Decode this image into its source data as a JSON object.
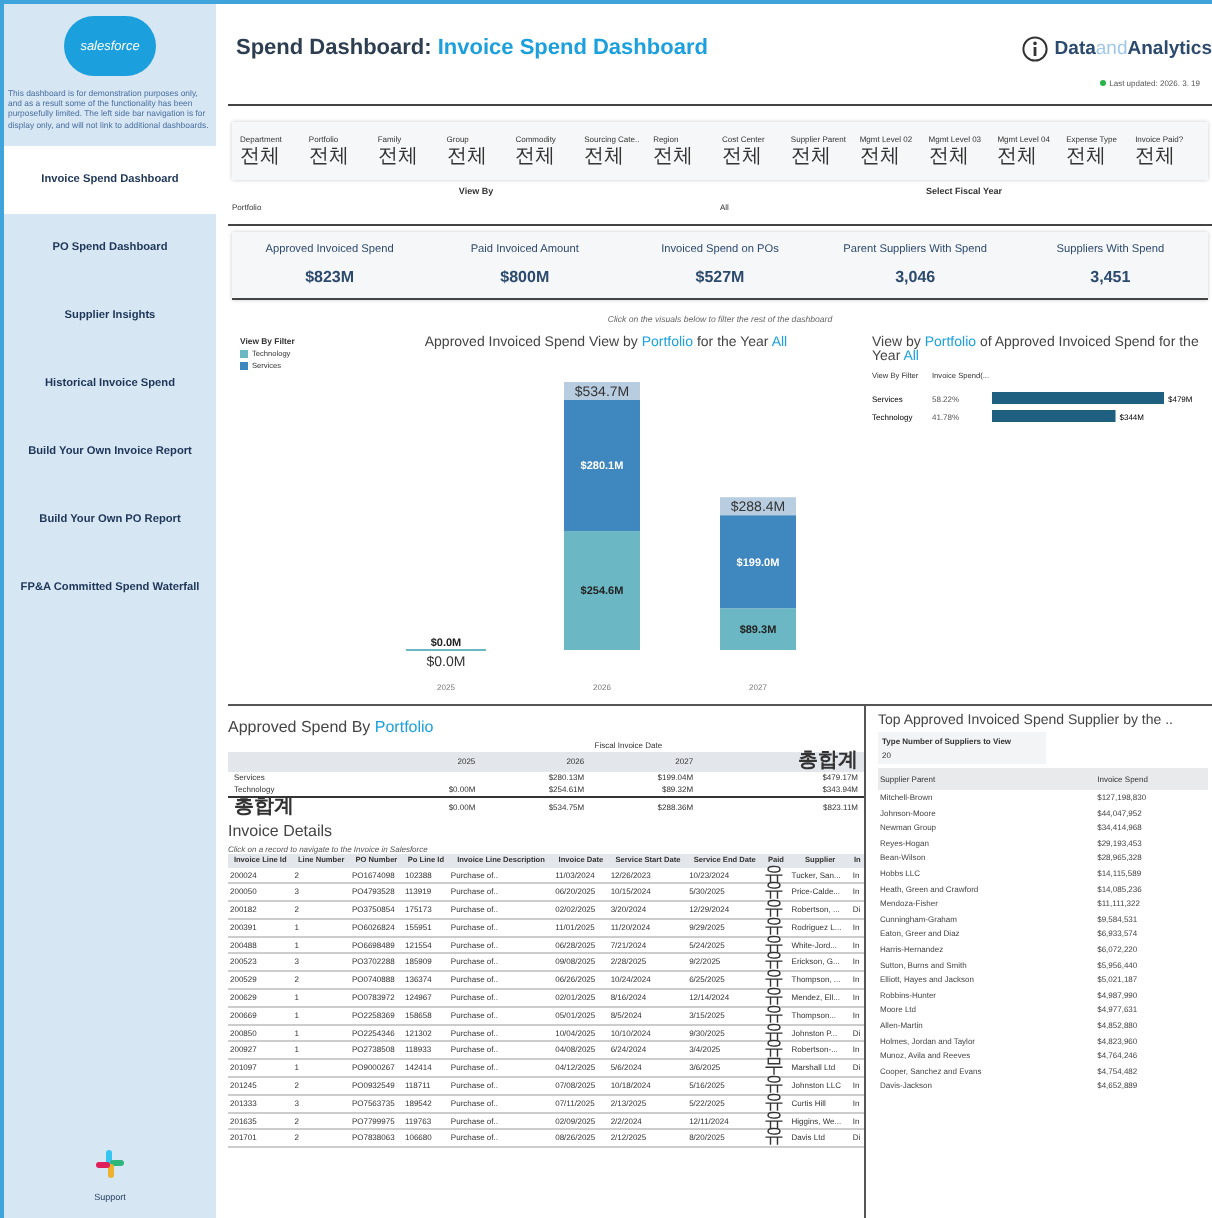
{
  "sidebar": {
    "logo": "salesforce",
    "description": "This dashboard is for demonstration purposes only, and as a result some of the functionality has been purposefully limited. The left side bar navigation is for display only, and will not link to additional dashboards.",
    "items": [
      {
        "label": "Invoice Spend Dashboard",
        "selected": true
      },
      {
        "label": "PO Spend Dashboard",
        "selected": false
      },
      {
        "label": "Supplier Insights",
        "selected": false
      },
      {
        "label": "Historical Invoice Spend",
        "selected": false
      },
      {
        "label": "Build Your Own Invoice Report",
        "selected": false
      },
      {
        "label": "Build Your Own PO Report",
        "selected": false
      },
      {
        "label": "FP&A Committed Spend Waterfall",
        "selected": false
      }
    ],
    "support": "Support"
  },
  "header": {
    "title": "Spend Dashboard:",
    "title_highlight": "Invoice Spend Dashboard",
    "brand": "Data",
    "brand_middle": "and",
    "brand_end": "Analytics",
    "updated": "Last updated: 2026. 3. 19"
  },
  "filters": [
    {
      "label": "Department",
      "value": "전체"
    },
    {
      "label": "Portfolio",
      "value": "전체"
    },
    {
      "label": "Family",
      "value": "전체"
    },
    {
      "label": "Group",
      "value": "전체"
    },
    {
      "label": "Commodity",
      "value": "전체"
    },
    {
      "label": "Sourcing Cate..",
      "value": "전체"
    },
    {
      "label": "Region",
      "value": "전체"
    },
    {
      "label": "Cost Center",
      "value": "전체"
    },
    {
      "label": "Supplier Parent",
      "value": "전체"
    },
    {
      "label": "Mgmt Level 02",
      "value": "전체"
    },
    {
      "label": "Mgmt Level 03",
      "value": "전체"
    },
    {
      "label": "Mgmt Level 04",
      "value": "전체"
    },
    {
      "label": "Expense Type",
      "value": "전체"
    },
    {
      "label": "Invoice Paid?",
      "value": "전체"
    }
  ],
  "view_by": {
    "label": "View By",
    "value": "Portfolio"
  },
  "fiscal_year": {
    "label": "Select Fiscal Year",
    "value": "All"
  },
  "kpis": [
    {
      "label": "Approved Invoiced Spend",
      "value": "$823M"
    },
    {
      "label": "Paid Invoiced Amount",
      "value": "$800M"
    },
    {
      "label": "Invoiced Spend on POs",
      "value": "$527M"
    },
    {
      "label": "Parent Suppliers With Spend",
      "value": "3,046"
    },
    {
      "label": "Suppliers With Spend",
      "value": "3,451"
    }
  ],
  "chart_hint": "Click on the visuals below to filter the rest of the dashboard",
  "stacked": {
    "title": [
      {
        "text": "Approved Invoiced Spend View by ",
        "highlight": false
      },
      {
        "text": "Portfolio",
        "highlight": true
      },
      {
        "text": " for the Year ",
        "highlight": false
      },
      {
        "text": "All",
        "highlight": true
      }
    ],
    "legend_title": "View By Filter",
    "total_labels": [
      "$0.0M",
      "$534.7M",
      "$288.4M"
    ],
    "chart_data": {
      "type": "bar",
      "stacked": true,
      "categories": [
        "2025",
        "2026",
        "2027"
      ],
      "series": [
        {
          "name": "Technology",
          "color": "#6bb8c4",
          "values": [
            0,
            254.6,
            89.3
          ],
          "value_labels": [
            "$0.0M",
            "$254.6M",
            "$89.3M"
          ]
        },
        {
          "name": "Services",
          "color": "#3f87bf",
          "values": [
            null,
            280.1,
            199.0
          ],
          "value_labels": [
            null,
            "$280.1M",
            "$199.0M"
          ]
        }
      ]
    }
  },
  "hbar": {
    "title": [
      {
        "text": "View by ",
        "highlight": false
      },
      {
        "text": "Portfolio",
        "highlight": true
      },
      {
        "text": " of Approved Invoiced Spend for the Year ",
        "highlight": false
      },
      {
        "text": "All",
        "highlight": true
      }
    ],
    "columns": [
      "View By Filter",
      "Invoice Spend(..."
    ],
    "shares": [
      "58.22%",
      "41.78%"
    ],
    "chart_data": {
      "type": "bar",
      "orientation": "horizontal",
      "categories": [
        "Services",
        "Technology"
      ],
      "series": [
        {
          "color": "#1f5f7f",
          "values": [
            479,
            344
          ],
          "value_labels": [
            "$479M",
            "$344M"
          ]
        }
      ]
    }
  },
  "pivot": {
    "title": "Approved Spend By ",
    "title_highlight": "Portfolio",
    "super_header": "Fiscal Invoice Date",
    "columns": [
      "2025",
      "2026",
      "2027",
      "총합계"
    ],
    "rows": [
      {
        "label": "Services",
        "cells": [
          null,
          "$280.13M",
          "$199.04M",
          "$479.17M"
        ]
      },
      {
        "label": "Technology",
        "cells": [
          "$0.00M",
          "$254.61M",
          "$89.32M",
          "$343.94M"
        ]
      }
    ],
    "total": {
      "label": "총합계",
      "cells": [
        "$0.00M",
        "$534.75M",
        "$288.36M",
        "$823.11M"
      ]
    }
  },
  "invoices": {
    "title": "Invoice Details",
    "subtitle": "Click on a record to navigate to the Invoice in Salesforce",
    "columns": [
      "Invoice Line Id",
      "Line Number",
      "PO Number",
      "Po Line Id",
      "Invoice Line Description",
      "Invoice Date",
      "Service Start Date",
      "Service End Date",
      "Paid",
      "Supplier",
      "In"
    ],
    "rows": [
      [
        "200024",
        "2",
        "PO1674098",
        "102388",
        "Purchase of..",
        "11/03/2024",
        "12/26/2023",
        "10/23/2024",
        "유",
        "Tucker, San...",
        "In"
      ],
      [
        "200050",
        "3",
        "PO4793528",
        "113919",
        "Purchase of..",
        "06/20/2025",
        "10/15/2024",
        "5/30/2025",
        "유",
        "Price-Calde...",
        "In"
      ],
      [
        "200182",
        "2",
        "PO3750854",
        "175173",
        "Purchase of..",
        "02/02/2025",
        "3/20/2024",
        "12/29/2024",
        "유",
        "Robertson, ...",
        "Di"
      ],
      [
        "200391",
        "1",
        "PO6026824",
        "155951",
        "Purchase of..",
        "11/01/2025",
        "11/20/2024",
        "9/29/2025",
        "유",
        "Rodriguez L...",
        "In"
      ],
      [
        "200488",
        "1",
        "PO6698489",
        "121554",
        "Purchase of..",
        "06/28/2025",
        "7/21/2024",
        "5/24/2025",
        "유",
        "White-Jord...",
        "In"
      ],
      [
        "200523",
        "3",
        "PO3702288",
        "185909",
        "Purchase of..",
        "09/08/2025",
        "2/28/2025",
        "9/2/2025",
        "유",
        "Erickson, G...",
        "In"
      ],
      [
        "200529",
        "2",
        "PO0740888",
        "136374",
        "Purchase of..",
        "06/26/2025",
        "10/24/2024",
        "6/25/2025",
        "유",
        "Thompson, ...",
        "In"
      ],
      [
        "200629",
        "1",
        "PO0783972",
        "124967",
        "Purchase of..",
        "02/01/2025",
        "8/16/2024",
        "12/14/2024",
        "유",
        "Mendez, Ell...",
        "In"
      ],
      [
        "200669",
        "1",
        "PO2258369",
        "158658",
        "Purchase of..",
        "05/01/2025",
        "8/5/2024",
        "3/15/2025",
        "유",
        "Thompson...",
        "In"
      ],
      [
        "200850",
        "1",
        "PO2254346",
        "121302",
        "Purchase of..",
        "10/04/2025",
        "10/10/2024",
        "9/30/2025",
        "유",
        "Johnston P...",
        "Di"
      ],
      [
        "200927",
        "1",
        "PO2738508",
        "118933",
        "Purchase of..",
        "04/08/2025",
        "6/24/2024",
        "3/4/2025",
        "유",
        "Robertson-...",
        "In"
      ],
      [
        "201097",
        "1",
        "PO9000267",
        "142414",
        "Purchase of..",
        "04/12/2025",
        "5/6/2024",
        "3/6/2025",
        "무",
        "Marshall Ltd",
        "Di"
      ],
      [
        "201245",
        "2",
        "PO0932549",
        "118711",
        "Purchase of..",
        "07/08/2025",
        "10/18/2024",
        "5/16/2025",
        "유",
        "Johnston LLC",
        "In"
      ],
      [
        "201333",
        "3",
        "PO7563735",
        "189542",
        "Purchase of..",
        "07/11/2025",
        "2/13/2025",
        "5/22/2025",
        "유",
        "Curtis Hill",
        "In"
      ],
      [
        "201635",
        "2",
        "PO7799975",
        "119763",
        "Purchase of..",
        "02/09/2025",
        "2/2/2024",
        "12/11/2024",
        "유",
        "Higgins, We...",
        "In"
      ],
      [
        "201701",
        "2",
        "PO7838063",
        "106680",
        "Purchase of..",
        "08/26/2025",
        "2/12/2025",
        "8/20/2025",
        "유",
        "Davis Ltd",
        "Di"
      ]
    ]
  },
  "top_suppliers": {
    "title": "Top Approved Invoiced Spend Supplier by the ..",
    "input_label": "Type Number of Suppliers to View",
    "input_value": "20",
    "columns": [
      "Supplier Parent",
      "Invoice Spend"
    ],
    "rows": [
      [
        "Mitchell-Brown",
        "$127,198,830"
      ],
      [
        "Johnson-Moore",
        "$44,047,952"
      ],
      [
        "Newman Group",
        "$34,414,968"
      ],
      [
        "Reyes-Hogan",
        "$29,193,453"
      ],
      [
        "Bean-Wilson",
        "$28,965,328"
      ],
      [
        "Hobbs LLC",
        "$14,115,589"
      ],
      [
        "Heath, Green and Crawford",
        "$14,085,236"
      ],
      [
        "Mendoza-Fisher",
        "$11,111,322"
      ],
      [
        "Cunningham-Graham",
        "$9,584,531"
      ],
      [
        "Eaton, Greer and Diaz",
        "$6,933,574"
      ],
      [
        "Harris-Hernandez",
        "$6,072,220"
      ],
      [
        "Sutton, Burns and Smith",
        "$5,956,440"
      ],
      [
        "Elliott, Hayes and Jackson",
        "$5,021,187"
      ],
      [
        "Robbins-Hunter",
        "$4,987,990"
      ],
      [
        "Moore Ltd",
        "$4,977,631"
      ],
      [
        "Allen-Martin",
        "$4,852,880"
      ],
      [
        "Holmes, Jordan and Taylor",
        "$4,823,960"
      ],
      [
        "Munoz, Avila and Reeves",
        "$4,764,246"
      ],
      [
        "Cooper, Sanchez and Evans",
        "$4,754,482"
      ],
      [
        "Davis-Jackson",
        "$4,652,889"
      ]
    ]
  }
}
